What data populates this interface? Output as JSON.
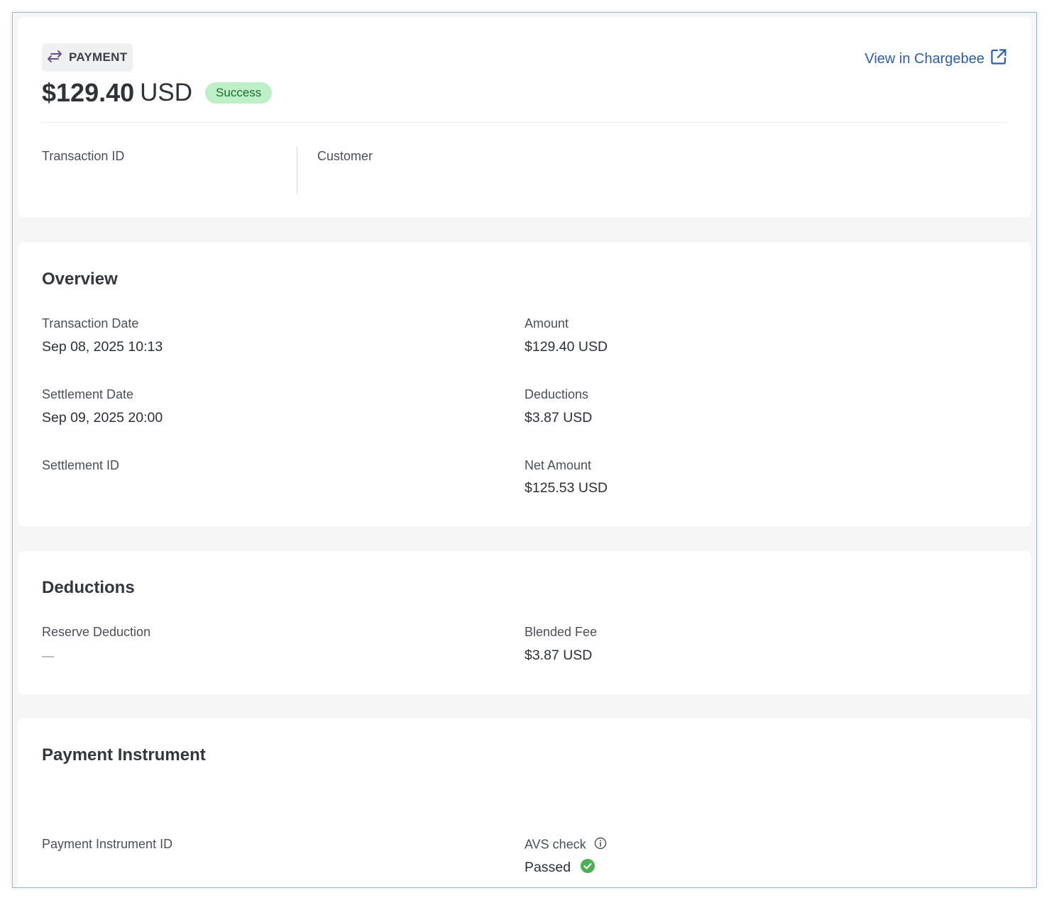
{
  "header": {
    "type_label": "PAYMENT",
    "amount": "$129.40",
    "currency": "USD",
    "status": "Success",
    "view_link": "View in Chargebee",
    "transaction_id_label": "Transaction ID",
    "customer_label": "Customer"
  },
  "overview": {
    "title": "Overview",
    "transaction_date_label": "Transaction Date",
    "transaction_date": "Sep 08, 2025 10:13",
    "settlement_date_label": "Settlement Date",
    "settlement_date": "Sep 09, 2025 20:00",
    "settlement_id_label": "Settlement ID",
    "amount_label": "Amount",
    "amount": "$129.40 USD",
    "deductions_label": "Deductions",
    "deductions": "$3.87 USD",
    "net_amount_label": "Net Amount",
    "net_amount": "$125.53 USD"
  },
  "deductions": {
    "title": "Deductions",
    "reserve_label": "Reserve Deduction",
    "blended_fee_label": "Blended Fee",
    "blended_fee": "$3.87 USD"
  },
  "payment_instrument": {
    "title": "Payment Instrument",
    "id_label": "Payment Instrument ID",
    "avs_label": "AVS check",
    "avs_value": "Passed"
  },
  "colors": {
    "link": "#2b5ea8",
    "success_bg": "#bdf0c6",
    "success_text": "#1f6b2d",
    "check_green": "#4caf50"
  }
}
